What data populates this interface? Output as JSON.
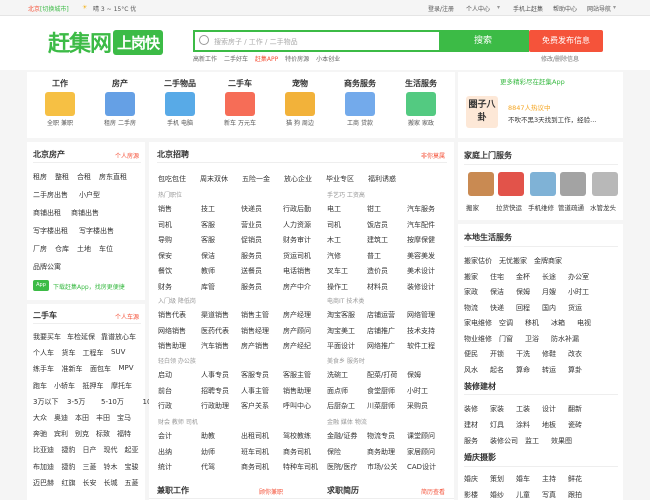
{
  "topbar": {
    "city": "北京",
    "switch": "[切换城市]",
    "weather": "晴  3 ~ 15°C  优",
    "login": "登录/注册",
    "user": "个人中心",
    "mobile": "手机上赶集",
    "help": "帮助中心",
    "nav": "网站导航"
  },
  "header": {
    "logo": "赶集网",
    "logo_sub": "上岗快",
    "search_placeholder": "搜索房子 / 工作 / 二手物品",
    "search_button": "搜索",
    "hot": [
      "高新工作",
      "二手好车",
      "赶集APP",
      "特价房源",
      "小本创业"
    ],
    "publish": "免费发布信息",
    "modify": "修改/删除信息"
  },
  "cats": [
    {
      "title": "工作",
      "subs": "全职  兼职",
      "color": "#f4b523"
    },
    {
      "title": "房产",
      "subs": "租房  二手房",
      "color": "#4a8fe0"
    },
    {
      "title": "二手物品",
      "subs": "手机  电脑",
      "color": "#3b9be3"
    },
    {
      "title": "二手车",
      "subs": "新车  万元车",
      "color": "#f5533a"
    },
    {
      "title": "宠物",
      "subs": "猫  狗  周边",
      "color": "#f0a418"
    },
    {
      "title": "商务服务",
      "subs": "工商  贷款",
      "color": "#5a9be8"
    },
    {
      "title": "生活服务",
      "subs": "搬家  家政",
      "color": "#35c16b"
    }
  ],
  "promo": {
    "link": "更多精彩尽在赶集App",
    "title": "圈子八卦",
    "count": "8847人热议中",
    "desc": "不吹不黑3天找到工作，经验..."
  },
  "house": {
    "title": "北京房产",
    "more": "个人房源",
    "links": [
      [
        "租房",
        "整租",
        "合租",
        "房东直租"
      ],
      [
        "二手房出售",
        "小户型"
      ],
      [
        "商铺出租",
        "商铺出售"
      ],
      [
        "写字楼出租",
        "写字楼出售"
      ],
      [
        "厂房",
        "仓库",
        "土地",
        "车位"
      ],
      [
        "品牌公寓"
      ]
    ],
    "app": "下载赶集App，找房更便捷"
  },
  "car": {
    "title": "二手车",
    "more": "个人车源",
    "links": [
      [
        "我要买车",
        "车检延保",
        "靠谱放心车"
      ],
      [
        "个人车",
        "货车",
        "工程车",
        "SUV"
      ],
      [
        "练手车",
        "准新车",
        "面包车",
        "MPV"
      ],
      [
        "跑车",
        "小轿车",
        "抵押车",
        "摩托车"
      ],
      [
        "3万以下",
        "3-5万",
        "5-10万",
        "10万"
      ],
      [
        "大众",
        "奥迪",
        "本田",
        "丰田",
        "宝马"
      ],
      [
        "奔驰",
        "宾利",
        "别克",
        "标致",
        "福特"
      ],
      [
        "比亚迪",
        "捷豹",
        "日产",
        "现代",
        "起亚"
      ],
      [
        "布加迪",
        "捷豹",
        "三菱",
        "铃木",
        "宝骏"
      ],
      [
        "迈巴赫",
        "红旗",
        "长安",
        "长城",
        "五菱"
      ]
    ]
  },
  "jobs": {
    "title": "北京招聘",
    "more": "非你莫属",
    "tags": [
      "包吃包住",
      "周末双休",
      "五险一金",
      "放心企业",
      "毕业专区",
      "福利诱惑"
    ],
    "groups": [
      {
        "left_tag": "热门职位",
        "right_tag": "手艺巧 工资高",
        "rows": [
          [
            "销售",
            "技工",
            "快递员",
            "行政后勤"
          ],
          [
            "司机",
            "客服",
            "营业员",
            "人力资源"
          ],
          [
            "导购",
            "客服",
            "促销员",
            "财务审计"
          ],
          [
            "保安",
            "保洁",
            "服务员",
            "货运司机"
          ],
          [
            "餐饮",
            "教师",
            "送餐员",
            "电话销售"
          ],
          [
            "财务",
            "库管",
            "服务员",
            "房产中介"
          ]
        ],
        "rows2": [
          [
            "电工",
            "钳工",
            "汽车服务"
          ],
          [
            "司机",
            "饭店员",
            "汽车配件"
          ],
          [
            "木工",
            "建筑工",
            "按摩保健"
          ],
          [
            "汽修",
            "普工",
            "美容美发"
          ],
          [
            "叉车工",
            "造价员",
            "美术设计"
          ],
          [
            "操作工",
            "材料员",
            "装修设计"
          ]
        ]
      },
      {
        "left_tag": "入门级 降低岗",
        "right_tag": "电商IT 技术类",
        "rows": [
          [
            "销售代表",
            "渠道销售",
            "销售主管",
            "房产经理"
          ],
          [
            "网络销售",
            "医药代表",
            "销售经理",
            "房产顾问"
          ],
          [
            "销售助理",
            "汽车销售",
            "房产销售",
            "房产经纪"
          ]
        ],
        "rows2": [
          [
            "淘宝客服",
            "店铺运营",
            "网络管理"
          ],
          [
            "淘宝美工",
            "店铺推广",
            "技术支持"
          ],
          [
            "平面设计",
            "网络推广",
            "软件工程"
          ]
        ]
      },
      {
        "left_tag": "轻白领 办公族",
        "right_tag": "美食乡 服务时",
        "rows": [
          [
            "启动",
            "人事专员",
            "客服专员",
            "客服主管"
          ],
          [
            "前台",
            "招聘专员",
            "人事主管",
            "销售助理"
          ],
          [
            "行政",
            "行政助理",
            "客户关系",
            "呼叫中心"
          ]
        ],
        "rows2": [
          [
            "洗碗工",
            "配菜/打荷",
            "保姆"
          ],
          [
            "面点师",
            "食堂厨师",
            "小时工"
          ],
          [
            "后厨杂工",
            "川菜厨师",
            "采购员"
          ]
        ]
      },
      {
        "left_tag": "财会 教师 司机",
        "right_tag": "金融 媒体 物流",
        "rows": [
          [
            "会计",
            "助教",
            "出租司机",
            "驾校教练"
          ],
          [
            "出纳",
            "幼师",
            "班车司机",
            "商务司机"
          ],
          [
            "统计",
            "代驾",
            "商务司机",
            "特种车司机"
          ]
        ],
        "rows2": [
          [
            "金融/证券",
            "物流专员",
            "课堂顾问"
          ],
          [
            "保险",
            "商务助理",
            "家居顾问"
          ],
          [
            "医院/医疗",
            "市场/公关",
            "CAD设计"
          ]
        ]
      }
    ],
    "parttime": "兼职工作",
    "parttime_more": "顾你兼职",
    "resume": "求职简历",
    "resume_more": "简历查看"
  },
  "home": {
    "title": "家庭上门服务",
    "items": [
      "搬家",
      "拉货快运",
      "手机维修",
      "管道疏通",
      "水管龙头"
    ]
  },
  "local": {
    "title": "本地生活服务",
    "rows": [
      [
        "搬家估价",
        "无忧搬家",
        "金牌商家"
      ],
      [
        "搬家",
        "住宅",
        "金杯",
        "长途",
        "办公室"
      ],
      [
        "家政",
        "保洁",
        "保姆",
        "月嫂",
        "小时工"
      ],
      [
        "物流",
        "快递",
        "回程",
        "国内",
        "货运"
      ],
      [
        "家电维修",
        "空调",
        "移机",
        "冰箱",
        "电视"
      ],
      [
        "物业维修",
        "门窗",
        "卫浴",
        "防水补漏"
      ],
      [
        "便民",
        "开锁",
        "干洗",
        "修鞋",
        "改衣"
      ],
      [
        "风水",
        "起名",
        "算命",
        "转运",
        "算卦"
      ]
    ]
  },
  "build": {
    "title": "装修建材",
    "rows": [
      [
        "装修",
        "家装",
        "工装",
        "设计",
        "翻新"
      ],
      [
        "建材",
        "灯具",
        "涂料",
        "地板",
        "瓷砖"
      ],
      [
        "服务",
        "装修公司",
        "监工",
        "效果图"
      ]
    ]
  },
  "wedding": {
    "title": "婚庆摄影",
    "rows": [
      [
        "婚庆",
        "策划",
        "婚车",
        "主持",
        "鲜花"
      ],
      [
        "影楼",
        "婚纱",
        "儿童",
        "写真",
        "跟拍"
      ]
    ]
  }
}
